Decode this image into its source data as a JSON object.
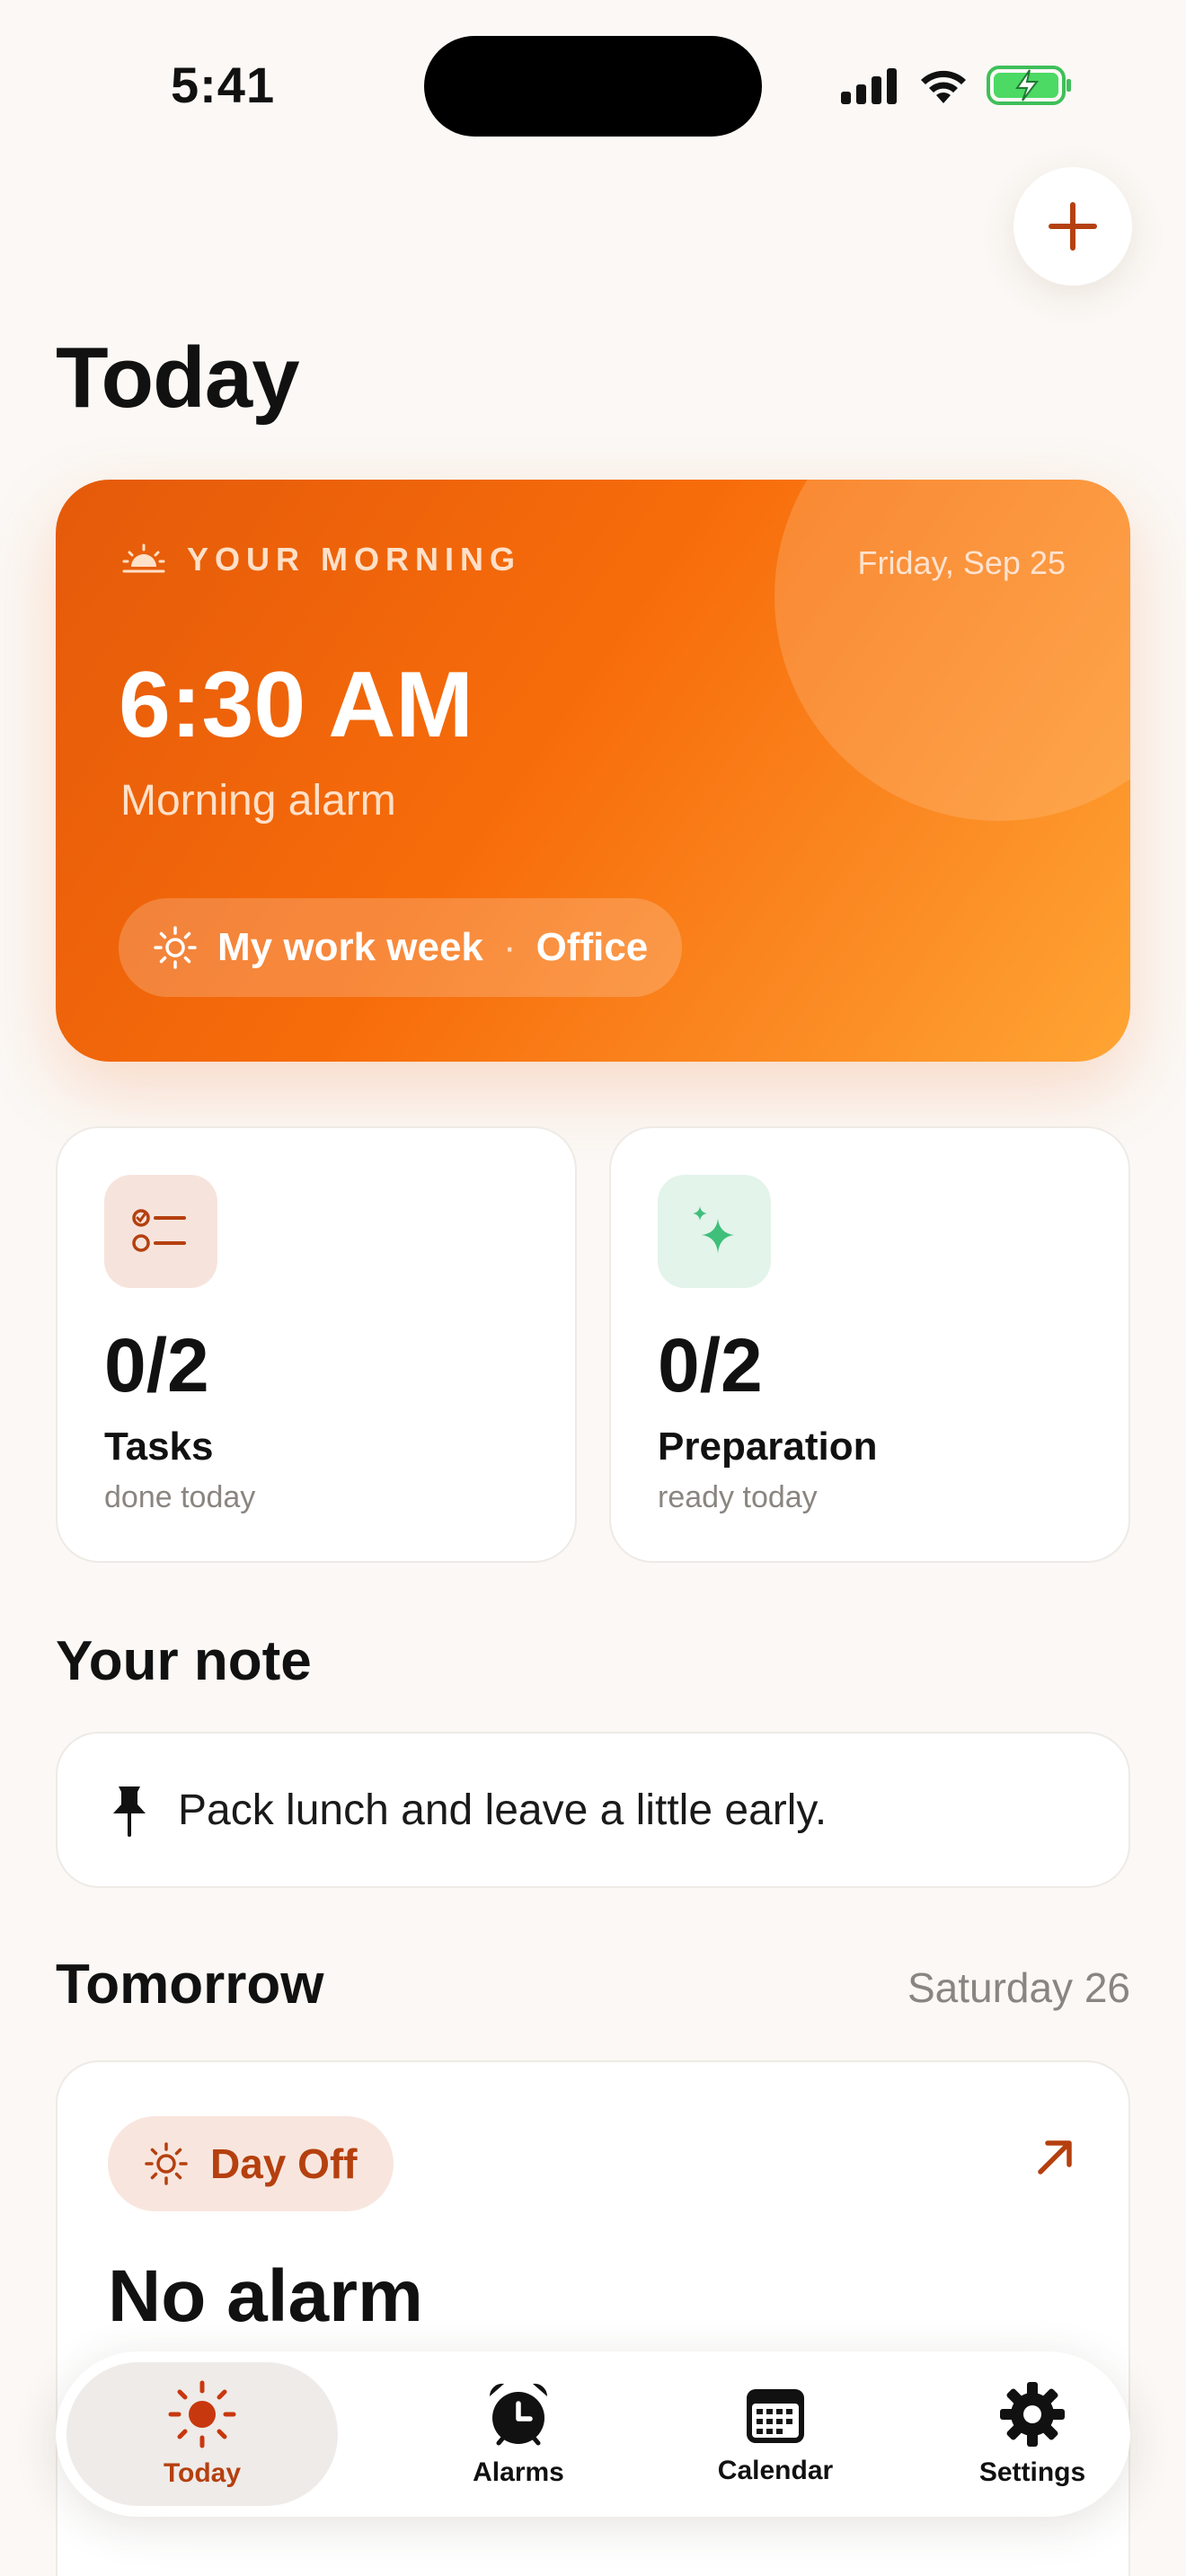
{
  "status_bar": {
    "time": "5:41"
  },
  "header": {
    "title": "Today",
    "add_button_label": "+"
  },
  "hero": {
    "kicker": "YOUR MORNING",
    "date": "Friday, Sep 25",
    "time": "6:30 AM",
    "subtitle": "Morning alarm",
    "schedule": "My work week",
    "separator": "·",
    "location": "Office",
    "icons": {
      "kicker": "sunrise-icon",
      "pill": "sun-icon"
    }
  },
  "stats": [
    {
      "value": "0/2",
      "label": "Tasks",
      "sub": "done today",
      "icon": "checklist-icon"
    },
    {
      "value": "0/2",
      "label": "Preparation",
      "sub": "ready today",
      "icon": "sparkles-icon"
    }
  ],
  "note": {
    "section_title": "Your note",
    "text": "Pack lunch and leave a little early.",
    "icon": "pin-icon"
  },
  "tomorrow": {
    "section_title": "Tomorrow",
    "date": "Saturday 26",
    "badge": "Day Off",
    "headline": "No alarm",
    "icon": "arrow-up-right-icon"
  },
  "tabs": [
    {
      "label": "Today",
      "icon": "sun-icon",
      "active": true
    },
    {
      "label": "Alarms",
      "icon": "alarm-clock-icon",
      "active": false
    },
    {
      "label": "Calendar",
      "icon": "calendar-icon",
      "active": false
    },
    {
      "label": "Settings",
      "icon": "gear-icon",
      "active": false
    }
  ],
  "colors": {
    "accent": "#b5400f",
    "hero_start": "#e45a0a",
    "hero_end": "#ffa534",
    "sparkle_green": "#3fbf7a",
    "background": "#fbf8f5"
  }
}
